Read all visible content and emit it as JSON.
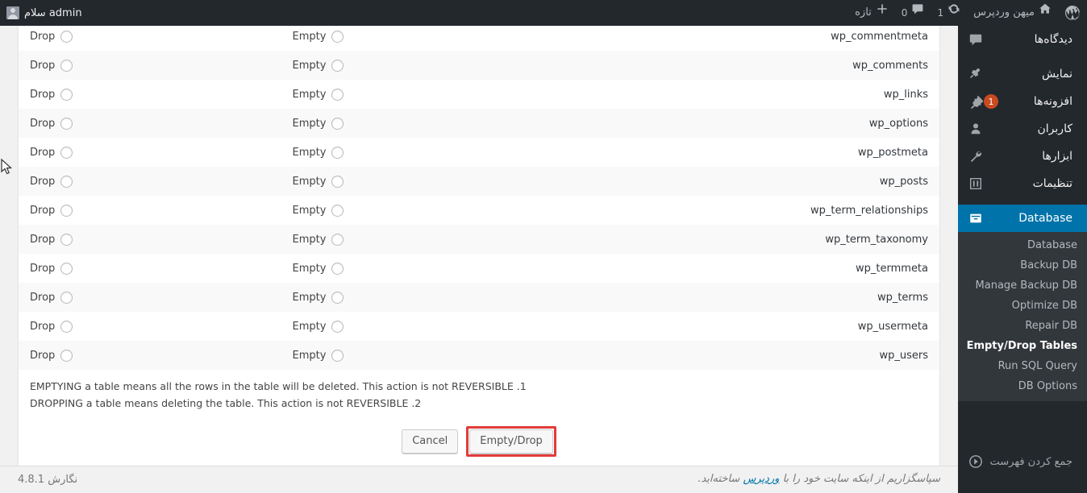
{
  "adminbar": {
    "greeting": "سلام admin",
    "site_name": "میهن وردپرس",
    "updates_count": "1",
    "comments_count": "0",
    "new_label": "تازه",
    "wp_logo_name": "wordpress-logo-icon",
    "home_icon": "home-icon",
    "updates_icon": "update-icon",
    "comments_icon": "comment-icon",
    "new_icon": "plus-icon",
    "avatar_name": "avatar"
  },
  "sidebar": {
    "items": [
      {
        "label": "دیدگاه‌ها",
        "icon": "comment-icon",
        "badge": ""
      },
      {
        "label": "نمایش",
        "icon": "appearance-icon",
        "badge": ""
      },
      {
        "label": "افزونه‌ها",
        "icon": "plugins-icon",
        "badge": "1"
      },
      {
        "label": "کاربران",
        "icon": "users-icon",
        "badge": ""
      },
      {
        "label": "ابزارها",
        "icon": "tools-icon",
        "badge": ""
      },
      {
        "label": "تنظیمات",
        "icon": "settings-icon",
        "badge": ""
      }
    ],
    "active_item": {
      "label": "Database",
      "icon": "database-icon"
    },
    "submenu": [
      {
        "label": "Database",
        "current": false
      },
      {
        "label": "Backup DB",
        "current": false
      },
      {
        "label": "Manage Backup DB",
        "current": false
      },
      {
        "label": "Optimize DB",
        "current": false
      },
      {
        "label": "Repair DB",
        "current": false
      },
      {
        "label": "Empty/Drop Tables",
        "current": true
      },
      {
        "label": "Run SQL Query",
        "current": false
      },
      {
        "label": "DB Options",
        "current": false
      }
    ],
    "collapse_label": "جمع کردن فهرست",
    "collapse_icon": "collapse-icon",
    "active_color": "#0073aa",
    "bg_color": "#23282d",
    "submenu_bg": "#32373c"
  },
  "table": {
    "empty_label": "Empty",
    "drop_label": "Drop",
    "rows": [
      {
        "name": "wp_commentmeta"
      },
      {
        "name": "wp_comments"
      },
      {
        "name": "wp_links"
      },
      {
        "name": "wp_options"
      },
      {
        "name": "wp_postmeta"
      },
      {
        "name": "wp_posts"
      },
      {
        "name": "wp_term_relationships"
      },
      {
        "name": "wp_term_taxonomy"
      },
      {
        "name": "wp_termmeta"
      },
      {
        "name": "wp_terms"
      },
      {
        "name": "wp_usermeta"
      },
      {
        "name": "wp_users"
      }
    ]
  },
  "notes": [
    "EMPTYING a table means all the rows in the table will be deleted. This action is not REVERSIBLE .1",
    "DROPPING a table means deleting the table. This action is not REVERSIBLE .2"
  ],
  "buttons": {
    "cancel": "Cancel",
    "submit": "Empty/Drop",
    "highlight_color": "#e23b3b"
  },
  "footer": {
    "version": "نگارش 4.8.1",
    "thanks_prefix": "سپاسگزاریم از اینکه سایت خود را با ",
    "thanks_link": "وردپرس",
    "thanks_suffix": " ساخته‌اید."
  }
}
